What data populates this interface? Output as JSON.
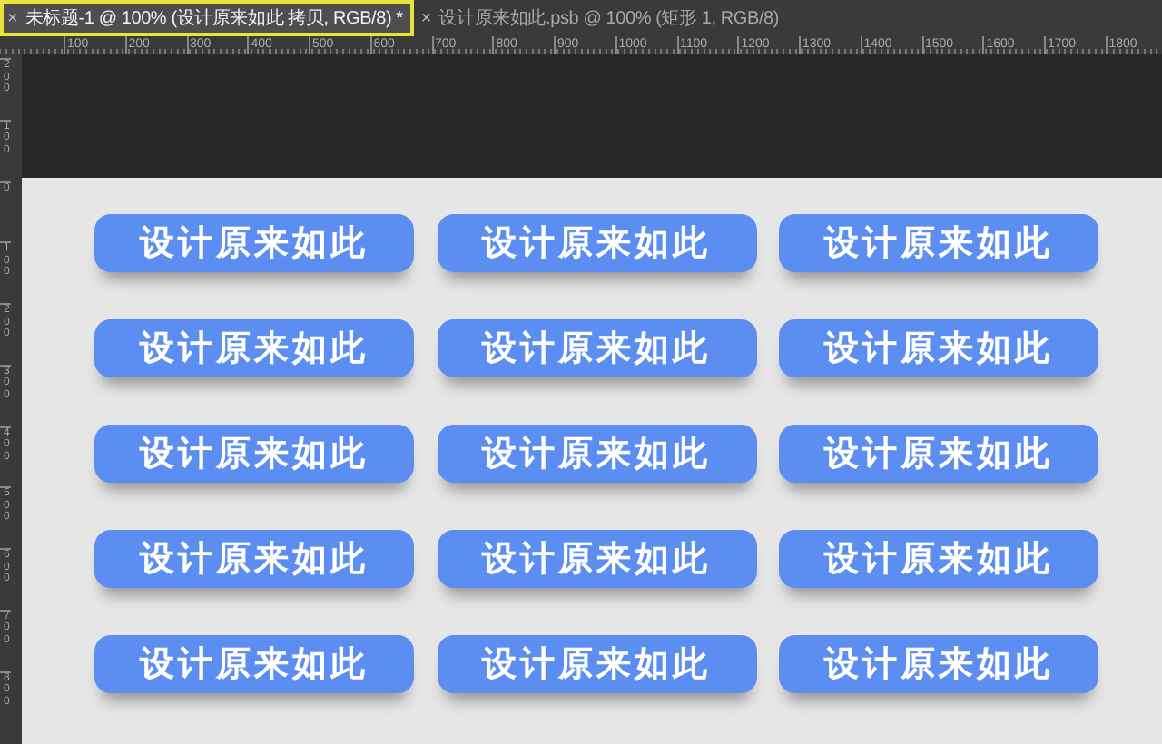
{
  "tabs": [
    {
      "close": "×",
      "label": "未标题-1 @ 100% (设计原来如此 拷贝, RGB/8) *",
      "selected": true,
      "highlighted": true
    },
    {
      "close": "×",
      "label": "设计原来如此.psb @ 100% (矩形 1, RGB/8)",
      "selected": false,
      "highlighted": false
    }
  ],
  "horizontal_ruler": [
    "100",
    "200",
    "300",
    "400",
    "500",
    "600",
    "700",
    "800",
    "900",
    "1000",
    "1100",
    "1200",
    "1300",
    "1400",
    "1500",
    "1600",
    "1700",
    "1800"
  ],
  "vertical_ruler": [
    "200",
    "100",
    "0",
    "100",
    "200",
    "300",
    "400",
    "500",
    "600",
    "700",
    "800"
  ],
  "buttons": [
    "设计原来如此",
    "设计原来如此",
    "设计原来如此",
    "设计原来如此",
    "设计原来如此",
    "设计原来如此",
    "设计原来如此",
    "设计原来如此",
    "设计原来如此",
    "设计原来如此",
    "设计原来如此",
    "设计原来如此",
    "设计原来如此",
    "设计原来如此",
    "设计原来如此"
  ]
}
